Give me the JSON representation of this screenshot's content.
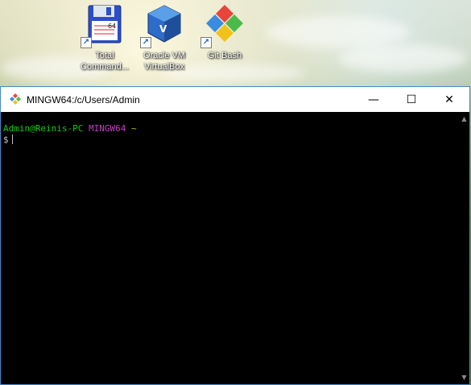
{
  "desktop": {
    "icons": [
      {
        "label": "Total Command...",
        "icon": "floppy-disk-icon"
      },
      {
        "label": "Oracle VM VirtualBox",
        "icon": "virtualbox-cube-icon"
      },
      {
        "label": "Git Bash",
        "icon": "git-diamond-icon"
      }
    ]
  },
  "window": {
    "title": "MINGW64:/c/Users/Admin",
    "controls": {
      "minimize": "—",
      "maximize": "☐",
      "close": "✕"
    }
  },
  "terminal": {
    "user_host": "Admin@Reinis-PC",
    "env": "MINGW64",
    "path": "~",
    "prompt": "$"
  },
  "colors": {
    "window_border": "#4a87c9",
    "terminal_bg": "#000000",
    "user_color": "#18c818",
    "env_color": "#c040c0",
    "path_color": "#c8c030"
  }
}
